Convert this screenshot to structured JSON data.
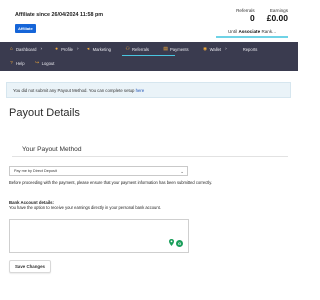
{
  "header": {
    "affiliate_since": "Affiliate since 26/04/2024 11:58 pm",
    "badge": "Affiliate",
    "referrals_label": "Referrals",
    "referrals_value": "0",
    "earnings_label": "Earnings",
    "earnings_value": "£0.00",
    "rank_prefix": "Until",
    "rank_name": "Associate",
    "rank_suffix": "Rank...",
    "rank_progress": 1.0,
    "rank_bar_color": "#6fd3e6"
  },
  "nav": {
    "background": "#3a3b4f",
    "icon_color": "#f0a93b",
    "items": [
      {
        "label": "Dashboard",
        "icon": "home-icon",
        "has_arrow": true
      },
      {
        "label": "Profile",
        "icon": "user-icon",
        "has_arrow": true
      },
      {
        "label": "Marketing",
        "icon": "megaphone-icon",
        "has_arrow": false
      },
      {
        "label": "Referrals",
        "icon": "referrals-icon",
        "has_arrow": false
      },
      {
        "label": "Payments",
        "icon": "payments-icon",
        "has_arrow": false
      },
      {
        "label": "Wallet",
        "icon": "wallet-icon",
        "has_arrow": true
      },
      {
        "label": "Reports",
        "icon": "",
        "has_arrow": false
      },
      {
        "label": "Help",
        "icon": "help-icon",
        "has_arrow": false
      },
      {
        "label": "Logout",
        "icon": "logout-icon",
        "has_arrow": false
      }
    ]
  },
  "notice": {
    "text_before": "You did not submit any Payout Method. You can complete setup ",
    "link": "here"
  },
  "page": {
    "title": "Payout Details",
    "section_title": "Your Payout Method",
    "payout_method_selected": "Pay me by Direct Deposit",
    "info": "Before proceeding with the payment, please ensure that your payment information has been submitted correctly.",
    "bank_label": "Bank Account details:",
    "bank_desc": "You have the option to receive your earnings directly in your personal bank account.",
    "bank_value": "",
    "save_label": "Save Changes"
  }
}
